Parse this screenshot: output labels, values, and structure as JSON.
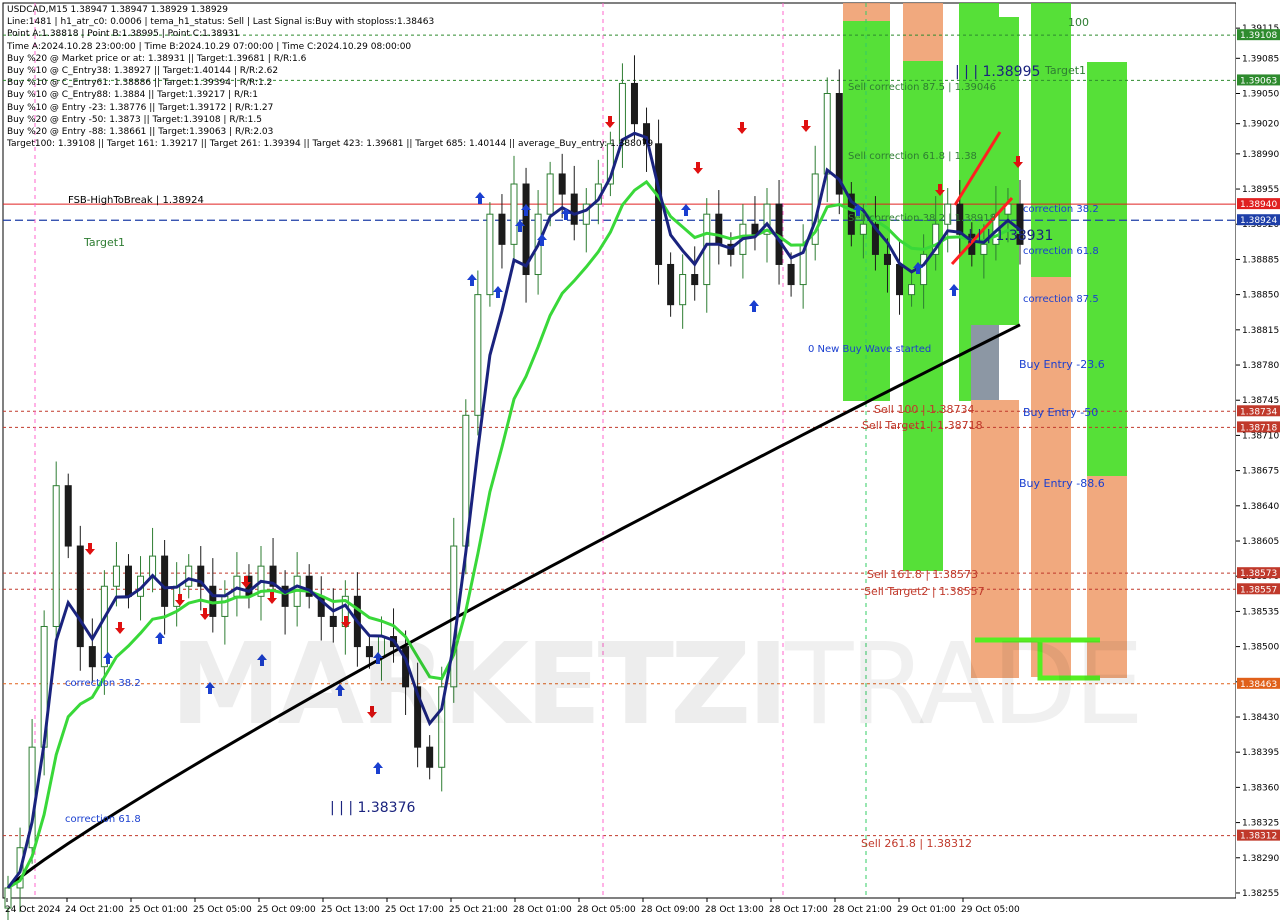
{
  "chart_data": {
    "type": "candlestick",
    "symbol_line": "USDCAD,M15  1.38947 1.38947 1.38929 1.38929",
    "info_lines": [
      "Line:1481 | h1_atr_c0: 0.0006 | tema_h1_status: Sell | Last Signal is:Buy with stoploss:1.38463",
      "Point A:1.38818 | Point B:1.38995 | Point C:1.38931",
      "Time A:2024.10.28 23:00:00 | Time B:2024.10.29 07:00:00 | Time C:2024.10.29 08:00:00",
      "Buy %20 @ Market price or at: 1.38931 || Target:1.39681 | R/R:1.6",
      "Buy %10 @ C_Entry38: 1.38927 || Target:1.40144 | R/R:2.62",
      "Buy %10 @ C_Entry61: 1.38886 || Target:1.39394 | R/R:1.2",
      "Buy %10 @ C_Entry88: 1.3884 || Target:1.39217 | R/R:1",
      "Buy %10 @ Entry -23: 1.38776 || Target:1.39172 | R/R:1.27",
      "Buy %20 @ Entry -50: 1.3873 || Target:1.39108 | R/R:1.5",
      "Buy %20 @ Entry -88: 1.38661 || Target:1.39063 | R/R:2.03",
      "Target100: 1.39108 || Target 161: 1.39217 || Target 261: 1.39394 || Target 423: 1.39681 || Target 685: 1.40144 || average_Buy_entry: 1.388079"
    ],
    "y_axis": {
      "min": 1.3825,
      "max": 1.3914,
      "ticks": [
        "1.39115",
        "1.39085",
        "1.39050",
        "1.39020",
        "1.38990",
        "1.38955",
        "1.38920",
        "1.38885",
        "1.38850",
        "1.38815",
        "1.38780",
        "1.38745",
        "1.38710",
        "1.38675",
        "1.38640",
        "1.38605",
        "1.38570",
        "1.38535",
        "1.38500",
        "1.38465",
        "1.38430",
        "1.38395",
        "1.38360",
        "1.38325",
        "1.38290",
        "1.38255"
      ]
    },
    "x_axis": {
      "labels": [
        "24 Oct 2024",
        "24 Oct 21:00",
        "25 Oct 01:00",
        "25 Oct 05:00",
        "25 Oct 09:00",
        "25 Oct 13:00",
        "25 Oct 17:00",
        "25 Oct 21:00",
        "28 Oct 01:00",
        "28 Oct 05:00",
        "28 Oct 09:00",
        "28 Oct 13:00",
        "28 Oct 17:00",
        "28 Oct 21:00",
        "29 Oct 01:00",
        "29 Oct 05:00"
      ]
    },
    "price_tags": [
      {
        "value": "1.39108",
        "color": "#2e8b2e"
      },
      {
        "value": "1.39063",
        "color": "#2e8b2e"
      },
      {
        "value": "1.38940",
        "color": "#e02020"
      },
      {
        "value": "1.38924",
        "color": "#1f3fa8"
      },
      {
        "value": "1.38734",
        "color": "#c0392b"
      },
      {
        "value": "1.38718",
        "color": "#c0392b"
      },
      {
        "value": "1.38573",
        "color": "#c0392b"
      },
      {
        "value": "1.38557",
        "color": "#c0392b"
      },
      {
        "value": "1.38463",
        "color": "#e0601a"
      },
      {
        "value": "1.38312",
        "color": "#c0392b"
      }
    ],
    "annotations": [
      {
        "text": "FSB-HighToBreak | 1.38924",
        "color": "#000000"
      },
      {
        "text": "Target1",
        "color": "#2e7d32"
      },
      {
        "text": "Target1",
        "color": "#2e7d32"
      },
      {
        "text": "100",
        "color": "#2e7d32"
      },
      {
        "text": "Sell correction 87.5 | 1.39046",
        "color": "#2e7d32"
      },
      {
        "text": "Sell correction 61.8 | 1.38",
        "color": "#2e7d32"
      },
      {
        "text": "Sell correction 38.2 | 1.38918",
        "color": "#2e7d32"
      },
      {
        "text": "| | | 1.38995",
        "color": "#1a237e"
      },
      {
        "text": "| | | 1.38931",
        "color": "#1a237e"
      },
      {
        "text": "| | | 1.38376",
        "color": "#1a237e"
      },
      {
        "text": "correction 38.2",
        "color": "#1a3fd0"
      },
      {
        "text": "correction 61.8",
        "color": "#1a3fd0"
      },
      {
        "text": "correction 87.5",
        "color": "#1a3fd0"
      },
      {
        "text": "Buy Entry -23.6",
        "color": "#1a3fd0"
      },
      {
        "text": "Buy Entry -50",
        "color": "#1a3fd0"
      },
      {
        "text": "Buy Entry -88.6",
        "color": "#1a3fd0"
      },
      {
        "text": "0 New Buy Wave started",
        "color": "#1a3fd0"
      },
      {
        "text": "Sell 100 | 1.38734",
        "color": "#c0392b"
      },
      {
        "text": "Sell Target1 | 1.38718",
        "color": "#c0392b"
      },
      {
        "text": "Sell 161.8 | 1.38573",
        "color": "#c0392b"
      },
      {
        "text": "Sell Target2 | 1.38557",
        "color": "#c0392b"
      },
      {
        "text": "Sell 261.8 | 1.38312",
        "color": "#c0392b"
      },
      {
        "text": "correction 38.2",
        "color": "#1a3fd0"
      },
      {
        "text": "correction 61.8",
        "color": "#1a3fd0"
      }
    ],
    "watermark": {
      "bold": "MARKETZI",
      "light": "TRADE"
    },
    "closes": [
      1.3826,
      1.383,
      1.384,
      1.3852,
      1.3866,
      1.386,
      1.385,
      1.3848,
      1.3856,
      1.3858,
      1.3855,
      1.3857,
      1.3859,
      1.3854,
      1.3856,
      1.3858,
      1.3856,
      1.3853,
      1.3855,
      1.3857,
      1.3855,
      1.3858,
      1.3856,
      1.3854,
      1.3857,
      1.3855,
      1.3853,
      1.3852,
      1.3855,
      1.385,
      1.3849,
      1.3851,
      1.385,
      1.3846,
      1.384,
      1.3838,
      1.3846,
      1.386,
      1.3873,
      1.3885,
      1.3893,
      1.389,
      1.3896,
      1.3887,
      1.3893,
      1.3897,
      1.3895,
      1.3892,
      1.3894,
      1.3896,
      1.39,
      1.3906,
      1.3902,
      1.39,
      1.3888,
      1.3884,
      1.3887,
      1.3886,
      1.3893,
      1.389,
      1.3889,
      1.3892,
      1.3891,
      1.3894,
      1.3888,
      1.3886,
      1.389,
      1.3897,
      1.3905,
      1.3895,
      1.3891,
      1.3892,
      1.3889,
      1.3888,
      1.3885,
      1.3886,
      1.3889,
      1.3892,
      1.3894,
      1.3891,
      1.3889,
      1.389,
      1.3893,
      1.3894,
      1.389
    ],
    "colors": {
      "bull": "#2e7d32",
      "bear": "#1b1b1b",
      "ema_fast": "#1a237e",
      "ema_mid": "#39d839",
      "ema_slow": "#000000",
      "green_zone": "#44dd22",
      "orange_zone": "#f0a070"
    }
  }
}
